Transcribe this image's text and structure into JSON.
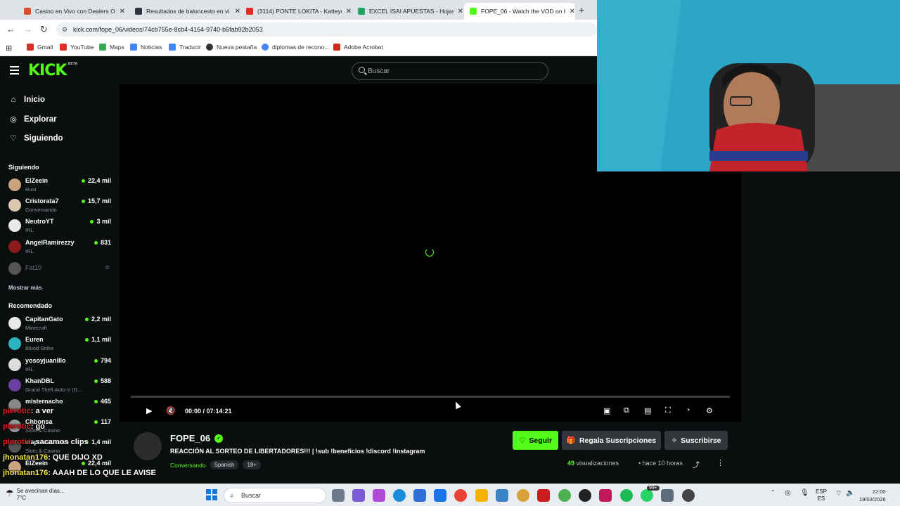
{
  "browser": {
    "tabs": [
      {
        "title": "Casino en Vivo con Dealers Onl",
        "color": "#e34b2f",
        "active": false
      },
      {
        "title": "Resultados de baloncesto en vi",
        "color": "#334",
        "active": false
      },
      {
        "title": "(3114) PONTE LOKITA - Katteye",
        "color": "#e52d27",
        "active": false
      },
      {
        "title": "EXCEL ISAI APUESTAS - Hojas d",
        "color": "#21a366",
        "active": false
      },
      {
        "title": "FOPE_06 - Watch the VOD on K",
        "color": "#53fc18",
        "active": true
      }
    ],
    "url": "kick.com/fope_06/videos/74cb755e-8cb4-4164-9740-b5fab92b2053",
    "bookmarks": [
      {
        "label": "Gmail",
        "color": "#d93025"
      },
      {
        "label": "YouTube",
        "color": "#e52d27"
      },
      {
        "label": "Maps",
        "color": "#34a853"
      },
      {
        "label": "Noticias",
        "color": "#4285f4"
      },
      {
        "label": "Traducir",
        "color": "#4285f4"
      },
      {
        "label": "Nueva pestaña",
        "color": "#333"
      },
      {
        "label": "diplomas de recono...",
        "color": "#4285f4"
      },
      {
        "label": "Adobe Acrobat",
        "color": "#d4271b"
      }
    ]
  },
  "header": {
    "logo": "KICK",
    "beta": "BETA",
    "search_placeholder": "Buscar"
  },
  "sidebar": {
    "nav": [
      {
        "label": "Inicio",
        "icon": "home-icon",
        "glyph": "⌂"
      },
      {
        "label": "Explorar",
        "icon": "compass-icon",
        "glyph": "◎"
      },
      {
        "label": "Siguiendo",
        "icon": "heart-icon",
        "glyph": "♡"
      }
    ],
    "following_title": "Siguiendo",
    "following": [
      {
        "name": "ElZeein",
        "category": "Rust",
        "viewers": "22,4 mil",
        "color": "#c9a27e"
      },
      {
        "name": "Cristorata7",
        "category": "Conversando",
        "viewers": "15,7 mil",
        "color": "#d9c7b0"
      },
      {
        "name": "NeutroYT",
        "category": "IRL",
        "viewers": "3 mil",
        "color": "#e8e8e8"
      },
      {
        "name": "AngelRamirezzy",
        "category": "IRL",
        "viewers": "831",
        "color": "#8b1c1c"
      }
    ],
    "offline": {
      "name": "Fat10",
      "status": "offline"
    },
    "show_more": "Mostrar más",
    "recommended_title": "Recomendado",
    "recommended": [
      {
        "name": "CapitanGato",
        "category": "Minecraft",
        "viewers": "2,2 mil",
        "color": "#e8e8e8"
      },
      {
        "name": "Euren",
        "category": "Blood Strike",
        "viewers": "1,1 mil",
        "color": "#2bb3c0"
      },
      {
        "name": "yosoyjuanillo",
        "category": "IRL",
        "viewers": "794",
        "color": "#ddd"
      },
      {
        "name": "KhanDBL",
        "category": "Grand Theft Auto V (G...",
        "viewers": "588",
        "color": "#6a3fa0"
      },
      {
        "name": "misternacho",
        "category": "",
        "viewers": "465",
        "color": "#888"
      },
      {
        "name": "Chbonsa",
        "category": "Slots & Casino",
        "viewers": "117",
        "color": "#999"
      },
      {
        "name": "elapostadorhn",
        "category": "Slots & Casino",
        "viewers": "1,4 mil",
        "color": "#555"
      },
      {
        "name": "ElZeein",
        "category": "",
        "viewers": "22,4 mil",
        "color": "#c9a27e"
      }
    ]
  },
  "player": {
    "time": "00:00 / 07:14:21",
    "progress": 0
  },
  "stream": {
    "name": "FOPE_06",
    "title": "REACCIÓN AL SORTEO DE LIBERTADORES!!! | !sub !beneficios !discord !instagram",
    "category": "Conversando",
    "tags": [
      "Spanish",
      "18+"
    ],
    "follow_label": "Seguir",
    "gift_label": "Regala Suscripciones",
    "subscribe_label": "Suscribirse",
    "views_count": "49",
    "views_label": "visualizaciones",
    "ago": "hace 10 horas"
  },
  "chat_overlay": [
    {
      "user": "pierotic",
      "msg": ": a ver",
      "ucolor": "u1"
    },
    {
      "user": "pierotic",
      "msg": ": go",
      "ucolor": "u1"
    },
    {
      "user": "pierotic",
      "msg": ": sacamos clips",
      "ucolor": "u1"
    },
    {
      "user": "jhonatan176",
      "msg": ": QUE DIJO XD",
      "ucolor": "u2"
    },
    {
      "user": "jhonatan176",
      "msg": ": AAAH DE LO QUE LE AVISE",
      "ucolor": "u2"
    }
  ],
  "taskbar": {
    "weather_line1": "Se avecinan días...",
    "weather_line2": "7°C",
    "search": "Buscar",
    "lang1": "ESP",
    "lang2": "ES",
    "time": "22:00",
    "date": "19/03/2026",
    "badge": "99+"
  }
}
